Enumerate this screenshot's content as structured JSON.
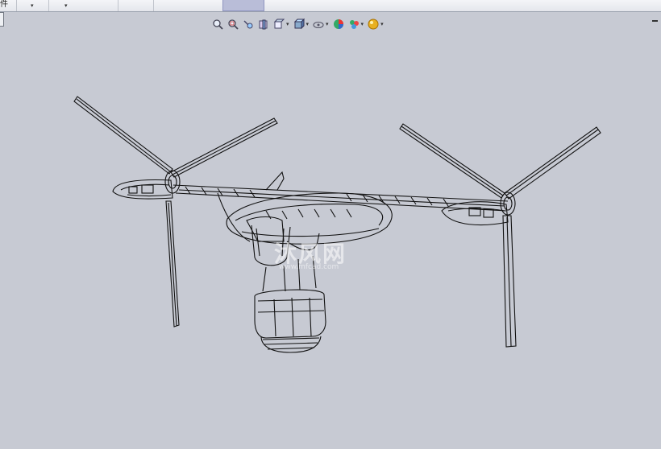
{
  "menu": {
    "part_label": "件",
    "dropdowns": [
      "▾",
      "▾"
    ]
  },
  "toolbar": {
    "icons": [
      "zoom-to-fit-icon",
      "zoom-area-icon",
      "previous-view-icon",
      "section-view-icon",
      "view-orientation-icon",
      "display-style-icon",
      "hide-show-icon",
      "edit-appearance-icon",
      "apply-scene-icon",
      "view-settings-icon"
    ]
  },
  "watermark": {
    "text": "沐风网",
    "url": "www.mfcad.com"
  },
  "colors": {
    "background": "#c7cad3",
    "wireframe": "#111111"
  }
}
